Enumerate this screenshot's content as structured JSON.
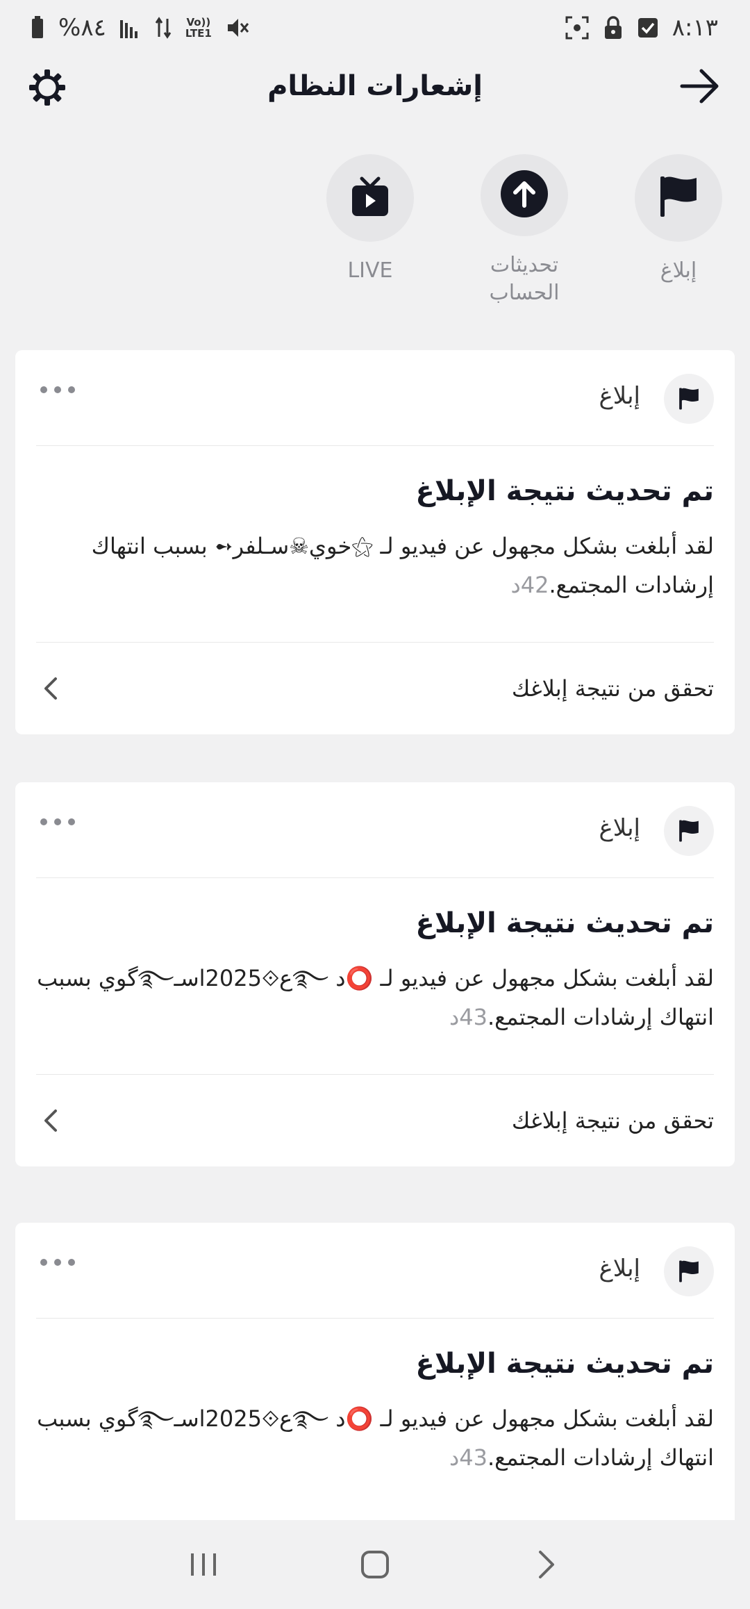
{
  "status_bar": {
    "time": "٨:١٣",
    "battery": "%٨٤",
    "network": "LTE1",
    "volte": "Vo))",
    "icons": [
      "screenshot-icon",
      "lock-icon",
      "checkbox-icon",
      "mute-icon",
      "data-arrows-icon",
      "signal-icon",
      "battery-icon"
    ]
  },
  "header": {
    "title": "إشعارات النظام",
    "back_icon": "arrow-right-icon",
    "settings_icon": "gear-icon"
  },
  "categories": [
    {
      "label": "إبلاغ",
      "icon": "flag-icon"
    },
    {
      "label": "تحديثات الحساب",
      "icon": "upload-arrow-icon"
    },
    {
      "label": "LIVE",
      "icon": "tv-play-icon"
    }
  ],
  "notifications": [
    {
      "type": "إبلاغ",
      "title": "تم تحديث نتيجة الإبلاغ",
      "text": "لقد أبلغت بشكل مجهول عن فيديو لـ ⚝خوي☠سـلفر➻ بسبب انتهاك إرشادات المجتمع.",
      "time": "42د",
      "action": "تحقق من نتيجة إبلاغك"
    },
    {
      "type": "إبلاغ",
      "title": "تم تحديث نتيجة الإبلاغ",
      "text": "لقد أبلغت بشكل مجهول عن فيديو لـ ⭕د ࿐ع⟐2025اسـ࿐گوي بسبب انتهاك إرشادات المجتمع.",
      "time": "43د",
      "action": "تحقق من نتيجة إبلاغك"
    },
    {
      "type": "إبلاغ",
      "title": "تم تحديث نتيجة الإبلاغ",
      "text": "لقد أبلغت بشكل مجهول عن فيديو لـ ⭕د ࿐ع⟐2025اسـ࿐گوي بسبب انتهاك إرشادات المجتمع.",
      "time": "43د",
      "action": ""
    }
  ],
  "navbar": {
    "icons": [
      "recent-apps-icon",
      "home-icon",
      "back-icon"
    ]
  },
  "colors": {
    "background": "#f1f1f2",
    "card": "#ffffff",
    "muted_text": "#8a8b91",
    "primary_text": "#161823"
  }
}
